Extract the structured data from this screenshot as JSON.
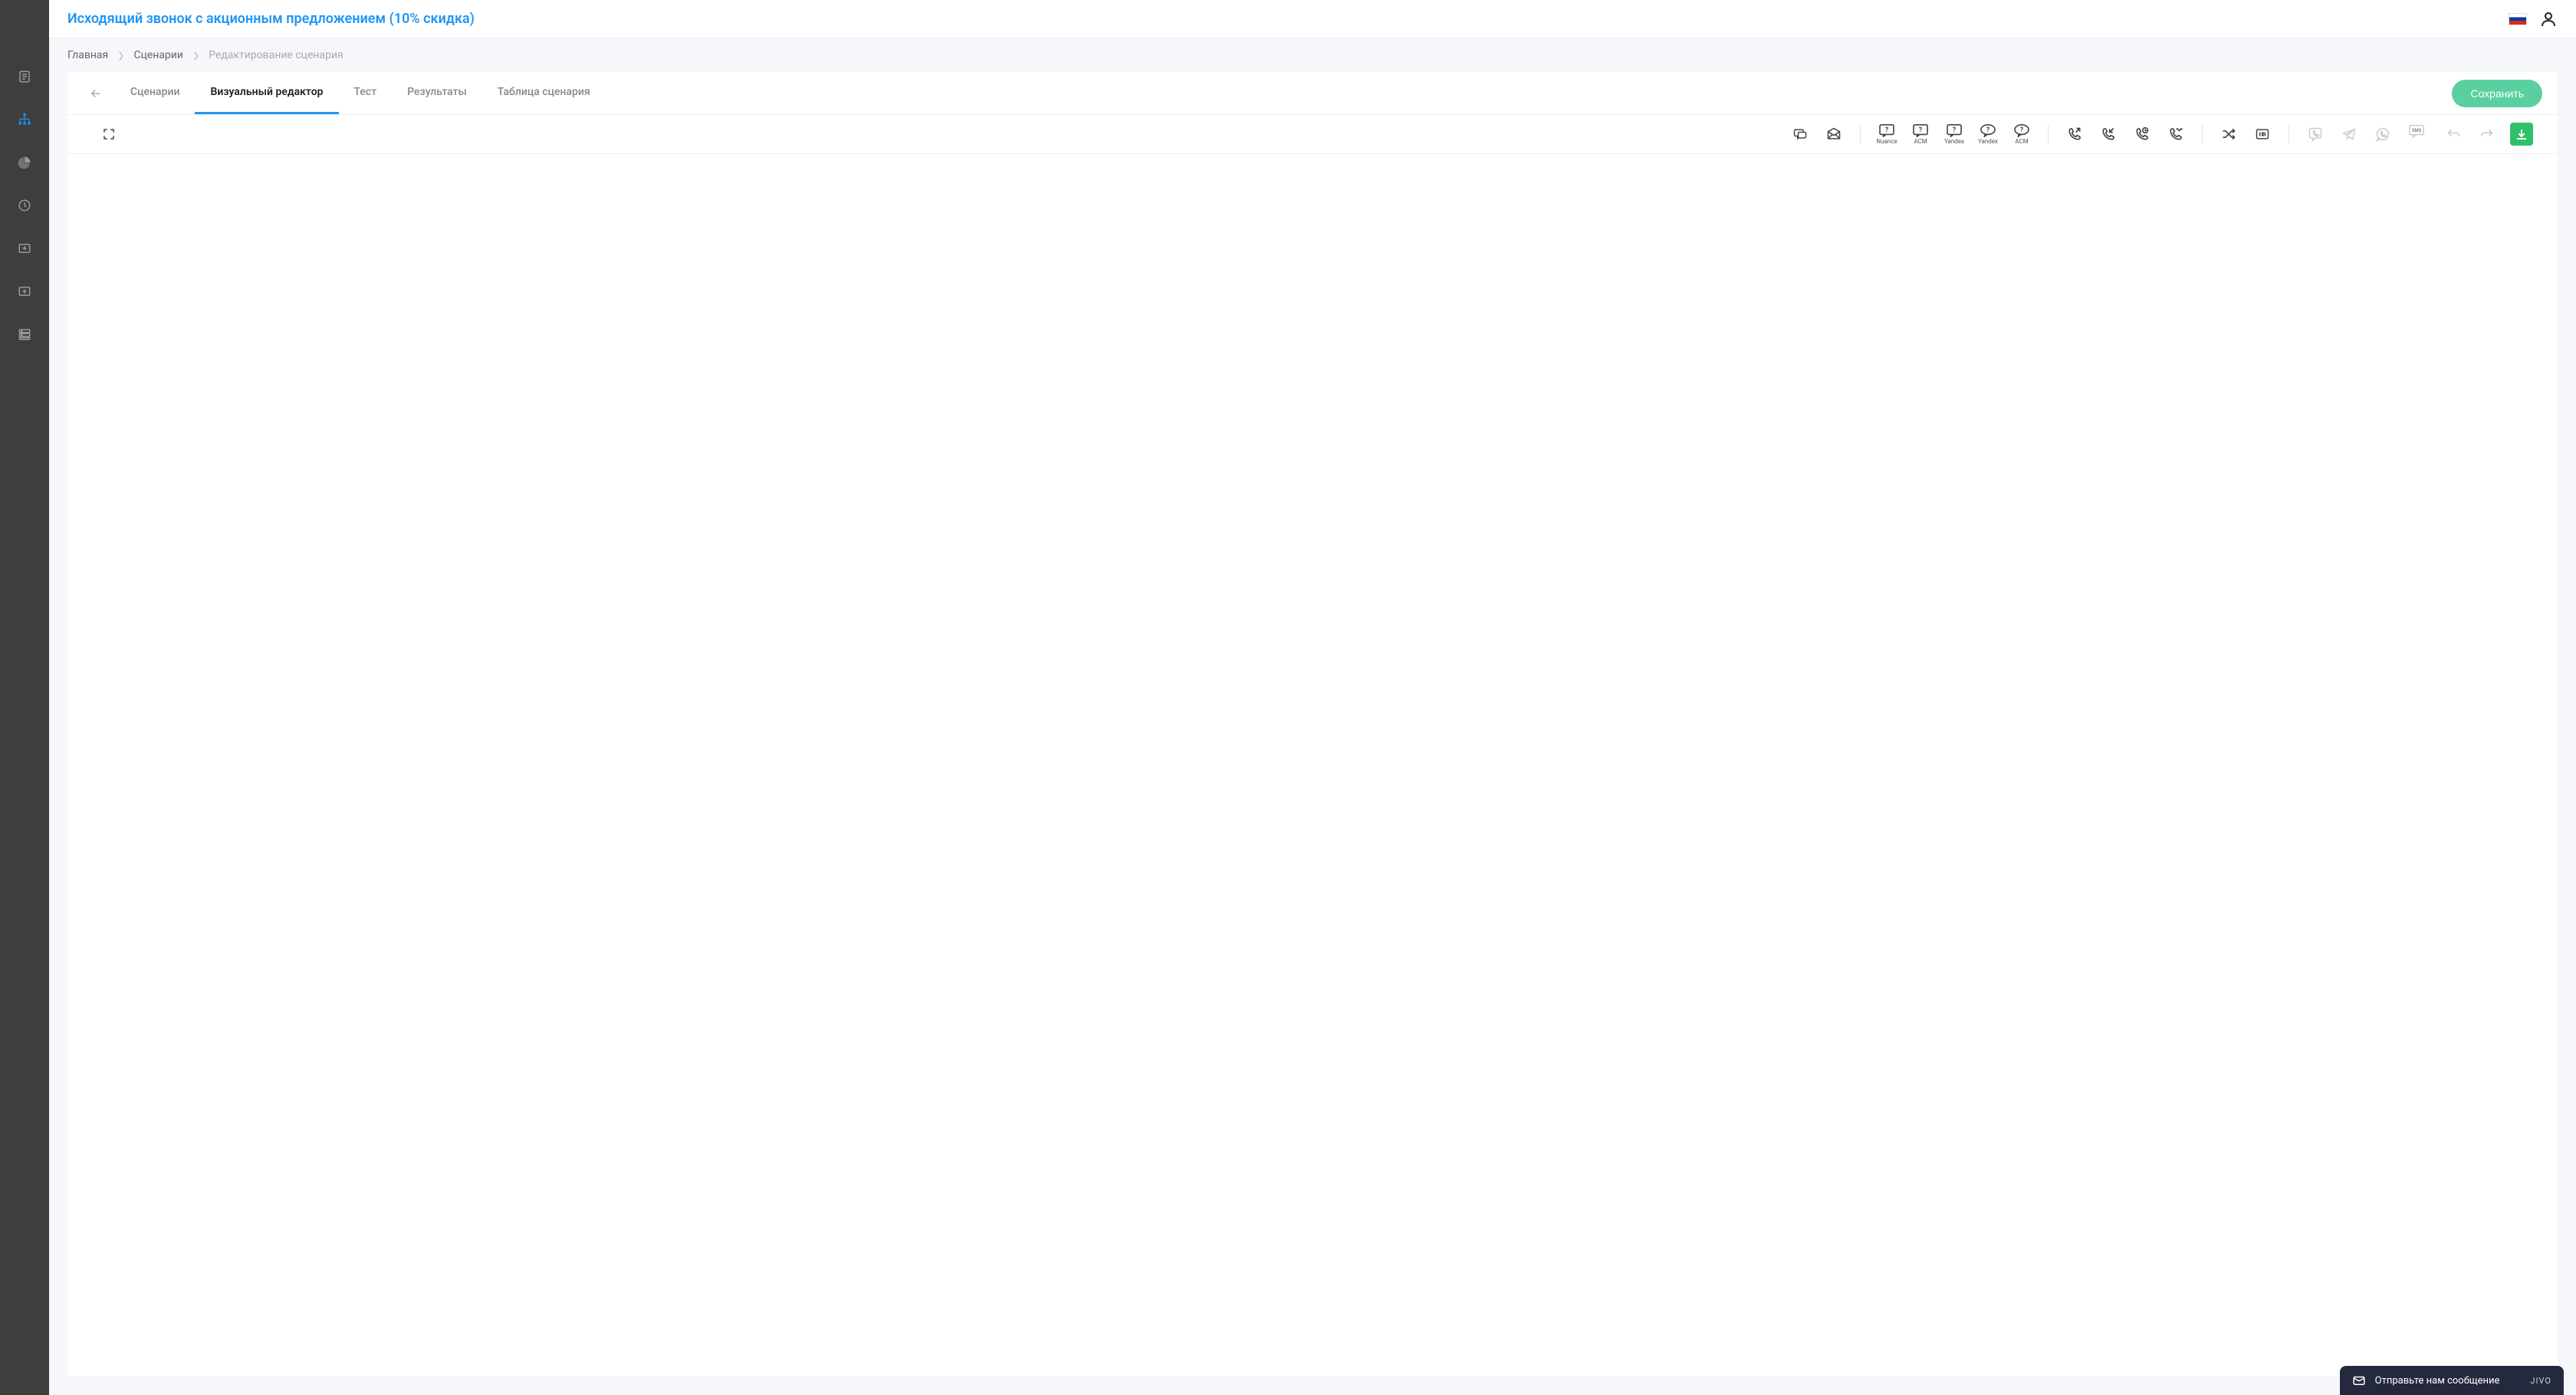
{
  "header": {
    "title": "Исходящий звонок с акционным предложением (10% скидка)"
  },
  "breadcrumb": {
    "home": "Главная",
    "scenarios": "Сценарии",
    "current": "Редактирование сценария"
  },
  "tabs": {
    "scenarios": "Сценарии",
    "visual": "Визуальный редактор",
    "test": "Тест",
    "results": "Результаты",
    "table": "Таблица сценария"
  },
  "buttons": {
    "save": "Сохранить"
  },
  "toolbar": {
    "nuance": "Nuance",
    "acm1": "ACM",
    "yandex1": "Yandex",
    "yandex2": "Yandex",
    "acm2": "ACM",
    "sms": "SMS"
  },
  "chat": {
    "message": "Отправьте нам сообщение",
    "brand": "JIVO"
  }
}
